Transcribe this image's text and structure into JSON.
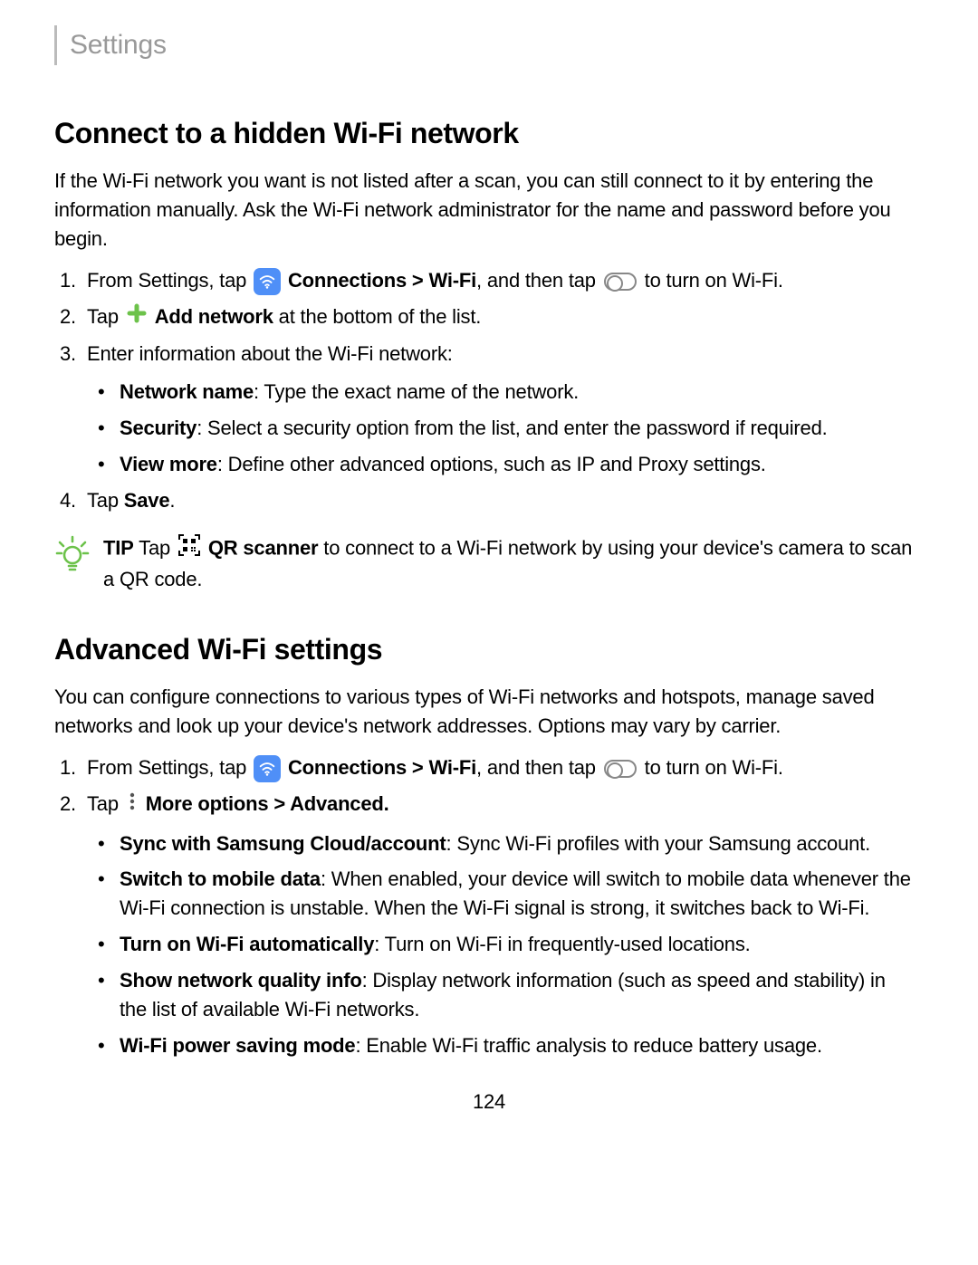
{
  "header": {
    "title": "Settings"
  },
  "section1": {
    "heading": "Connect to a hidden Wi-Fi network",
    "intro": "If the Wi-Fi network you want is not listed after a scan, you can still connect to it by entering the information manually. Ask the Wi-Fi network administrator for the name and password before you begin.",
    "step1_pre": "From Settings, tap",
    "step1_conn": "Connections > Wi-Fi",
    "step1_mid": ", and then tap",
    "step1_post": "to turn on Wi-Fi.",
    "step2_pre": "Tap",
    "step2_bold": "Add network",
    "step2_post": "at the bottom of the list.",
    "step3": "Enter information about the Wi-Fi network:",
    "bullets": {
      "b1_label": "Network name",
      "b1_text": ": Type the exact name of the network.",
      "b2_label": "Security",
      "b2_text": ": Select a security option from the list, and enter the password if required.",
      "b3_label": "View more",
      "b3_text": ": Define other advanced options, such as IP and Proxy settings."
    },
    "step4_pre": "Tap ",
    "step4_bold": "Save",
    "step4_post": ".",
    "tip_label": "TIP",
    "tip_pre": " Tap",
    "tip_bold": "QR scanner",
    "tip_post": "to connect to a Wi-Fi network by using your device's camera to scan a QR code."
  },
  "section2": {
    "heading": "Advanced Wi-Fi settings",
    "intro": "You can configure connections to various types of Wi-Fi networks and hotspots, manage saved networks and look up your device's network addresses. Options may vary by carrier.",
    "step1_pre": "From Settings, tap",
    "step1_conn": "Connections > Wi-Fi",
    "step1_mid": ", and then tap",
    "step1_post": "to turn on Wi-Fi.",
    "step2_pre": "Tap",
    "step2_bold": "More options > Advanced.",
    "bullets": {
      "b1_label": "Sync with Samsung Cloud/account",
      "b1_text": ": Sync Wi-Fi profiles with your Samsung account.",
      "b2_label": "Switch to mobile data",
      "b2_text": ": When enabled, your device will switch to mobile data whenever the Wi-Fi connection is unstable. When the Wi-Fi signal is strong, it switches back to Wi-Fi.",
      "b3_label": "Turn on Wi-Fi automatically",
      "b3_text": ": Turn on Wi-Fi in frequently-used locations.",
      "b4_label": "Show network quality info",
      "b4_text": ": Display network information (such as speed and stability) in the list of available Wi-Fi networks.",
      "b5_label": "Wi-Fi power saving mode",
      "b5_text": ": Enable Wi-Fi traffic analysis to reduce battery usage."
    }
  },
  "page_number": "124"
}
